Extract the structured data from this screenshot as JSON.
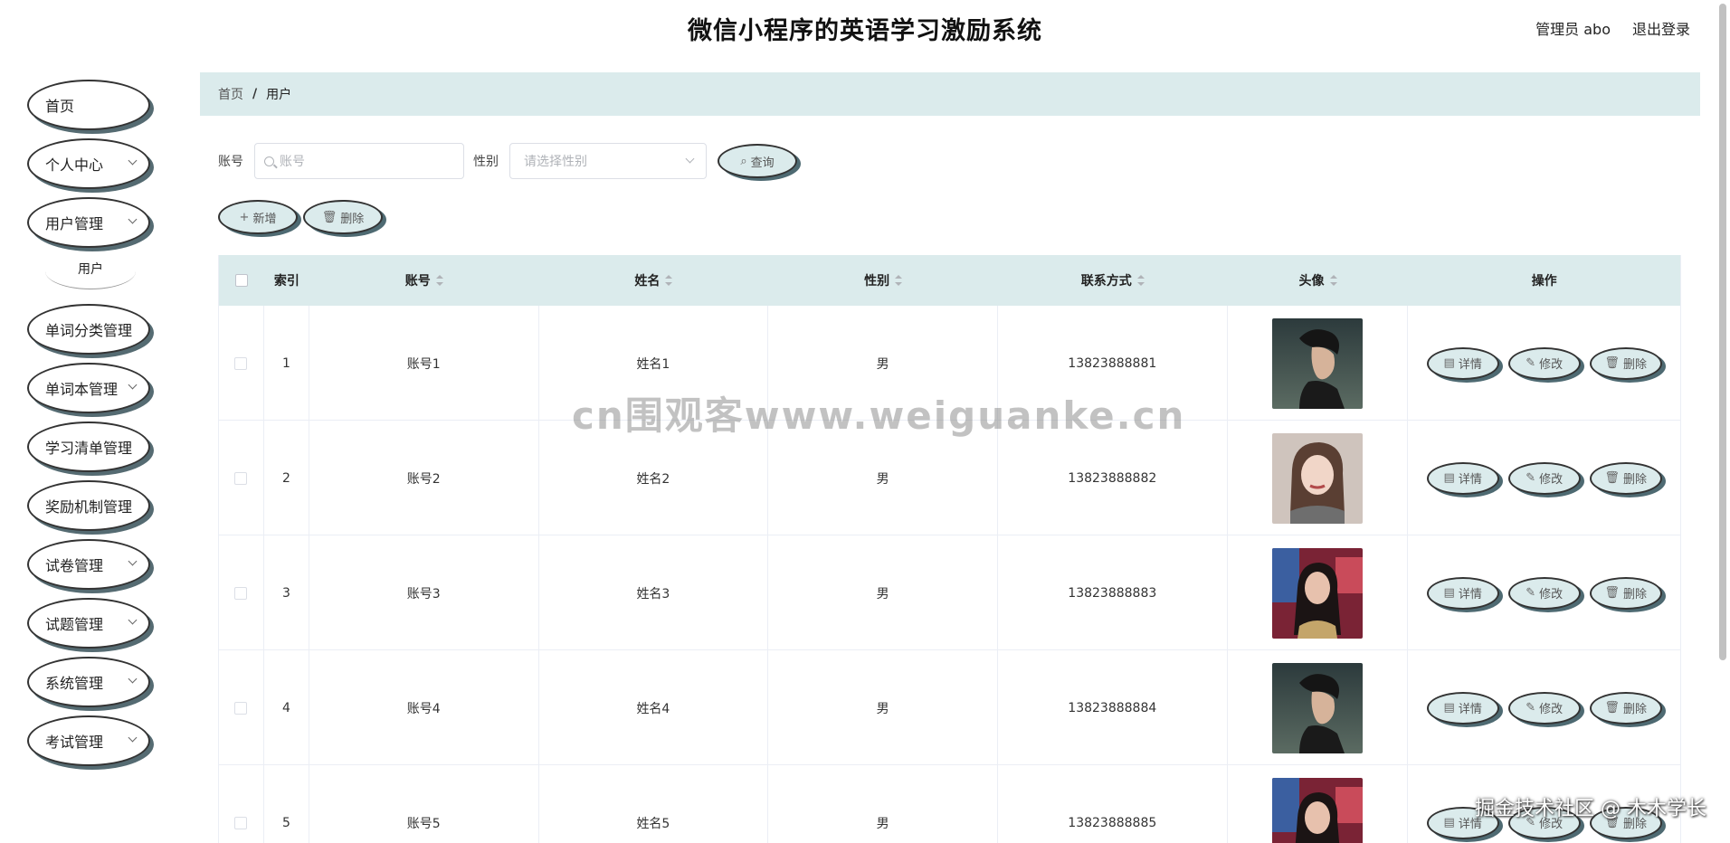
{
  "header": {
    "title": "微信小程序的英语学习激励系统",
    "user": "管理员 abo",
    "logout": "退出登录"
  },
  "sidebar": {
    "items": [
      {
        "label": "首页",
        "has_children": false
      },
      {
        "label": "个人中心",
        "has_children": true
      },
      {
        "label": "用户管理",
        "has_children": true
      },
      {
        "label": "单词分类管理",
        "has_children": false
      },
      {
        "label": "单词本管理",
        "has_children": true
      },
      {
        "label": "学习清单管理",
        "has_children": false
      },
      {
        "label": "奖励机制管理",
        "has_children": false
      },
      {
        "label": "试卷管理",
        "has_children": true
      },
      {
        "label": "试题管理",
        "has_children": true
      },
      {
        "label": "系统管理",
        "has_children": true
      },
      {
        "label": "考试管理",
        "has_children": true
      }
    ],
    "sub_item": "用户"
  },
  "breadcrumb": {
    "home": "首页",
    "separator": "/",
    "current": "用户"
  },
  "search": {
    "account_label": "账号",
    "account_placeholder": "账号",
    "gender_label": "性别",
    "gender_placeholder": "请选择性别",
    "query_label": "查询"
  },
  "actions": {
    "add_label": "新增",
    "delete_label": "删除"
  },
  "table": {
    "columns": [
      "索引",
      "账号",
      "姓名",
      "性别",
      "联系方式",
      "头像",
      "操作"
    ],
    "rows": [
      {
        "index": "1",
        "account": "账号1",
        "name": "姓名1",
        "gender": "男",
        "phone": "13823888881",
        "avatar": "male"
      },
      {
        "index": "2",
        "account": "账号2",
        "name": "姓名2",
        "gender": "男",
        "phone": "13823888882",
        "avatar": "female-a"
      },
      {
        "index": "3",
        "account": "账号3",
        "name": "姓名3",
        "gender": "男",
        "phone": "13823888883",
        "avatar": "female-b"
      },
      {
        "index": "4",
        "account": "账号4",
        "name": "姓名4",
        "gender": "男",
        "phone": "13823888884",
        "avatar": "male"
      },
      {
        "index": "5",
        "account": "账号5",
        "name": "姓名5",
        "gender": "男",
        "phone": "13823888885",
        "avatar": "female-b"
      }
    ],
    "row_actions": {
      "detail": "详情",
      "edit": "修改",
      "delete": "删除"
    }
  },
  "overlays": {
    "watermark": "cn围观客www.weiguanke.cn",
    "community": "掘金技术社区 @ 木木学长"
  },
  "colors": {
    "accent": "#dbebec",
    "oval_shadow": "#4e6a72"
  }
}
